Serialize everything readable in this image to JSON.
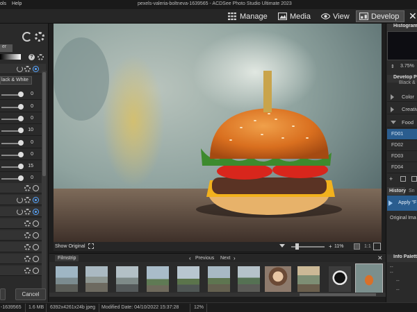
{
  "titlebar": {
    "menu_left": "ols",
    "menu_help": "Help",
    "title": "pexels-valeria-boltneva-1639565 - ACDSee Photo Studio Ultimate 2023"
  },
  "modes": {
    "manage": "Manage",
    "media": "Media",
    "view": "View",
    "develop": "Develop"
  },
  "left_panel": {
    "tab_label": "er",
    "preset_label": "lack & White",
    "slider_values": [
      "0",
      "0",
      "0",
      "10",
      "0",
      "0",
      "15",
      "0"
    ]
  },
  "viewer": {
    "show_original": "Show Original",
    "zoom": "11%",
    "ratio": "1:1"
  },
  "filmstrip": {
    "title": "Filmstrip",
    "previous": "Previous",
    "next": "Next"
  },
  "right_panel": {
    "histogram": "Histogram",
    "percent": "3.75%",
    "develop_presets": "Develop Pr",
    "black": "Black &",
    "color": "Color",
    "creative": "Creativ",
    "food": "Food",
    "fd_items": [
      "FD01",
      "FD02",
      "FD03",
      "FD04"
    ],
    "history": "History",
    "snapshots": "Sn",
    "apply": "Apply \"F",
    "original": "Original Ima",
    "info_palette": "Info Palette",
    "info_rows": [
      "--",
      "--",
      "--",
      "--"
    ]
  },
  "buttons": {
    "cancel": "Cancel"
  },
  "status": {
    "name": "-1639565",
    "size": "1.6 MB",
    "dims": "6392x4261x24b jpeg",
    "modified": "Modified Date: 04/10/2022 15:37:28",
    "zoom": "12%"
  }
}
